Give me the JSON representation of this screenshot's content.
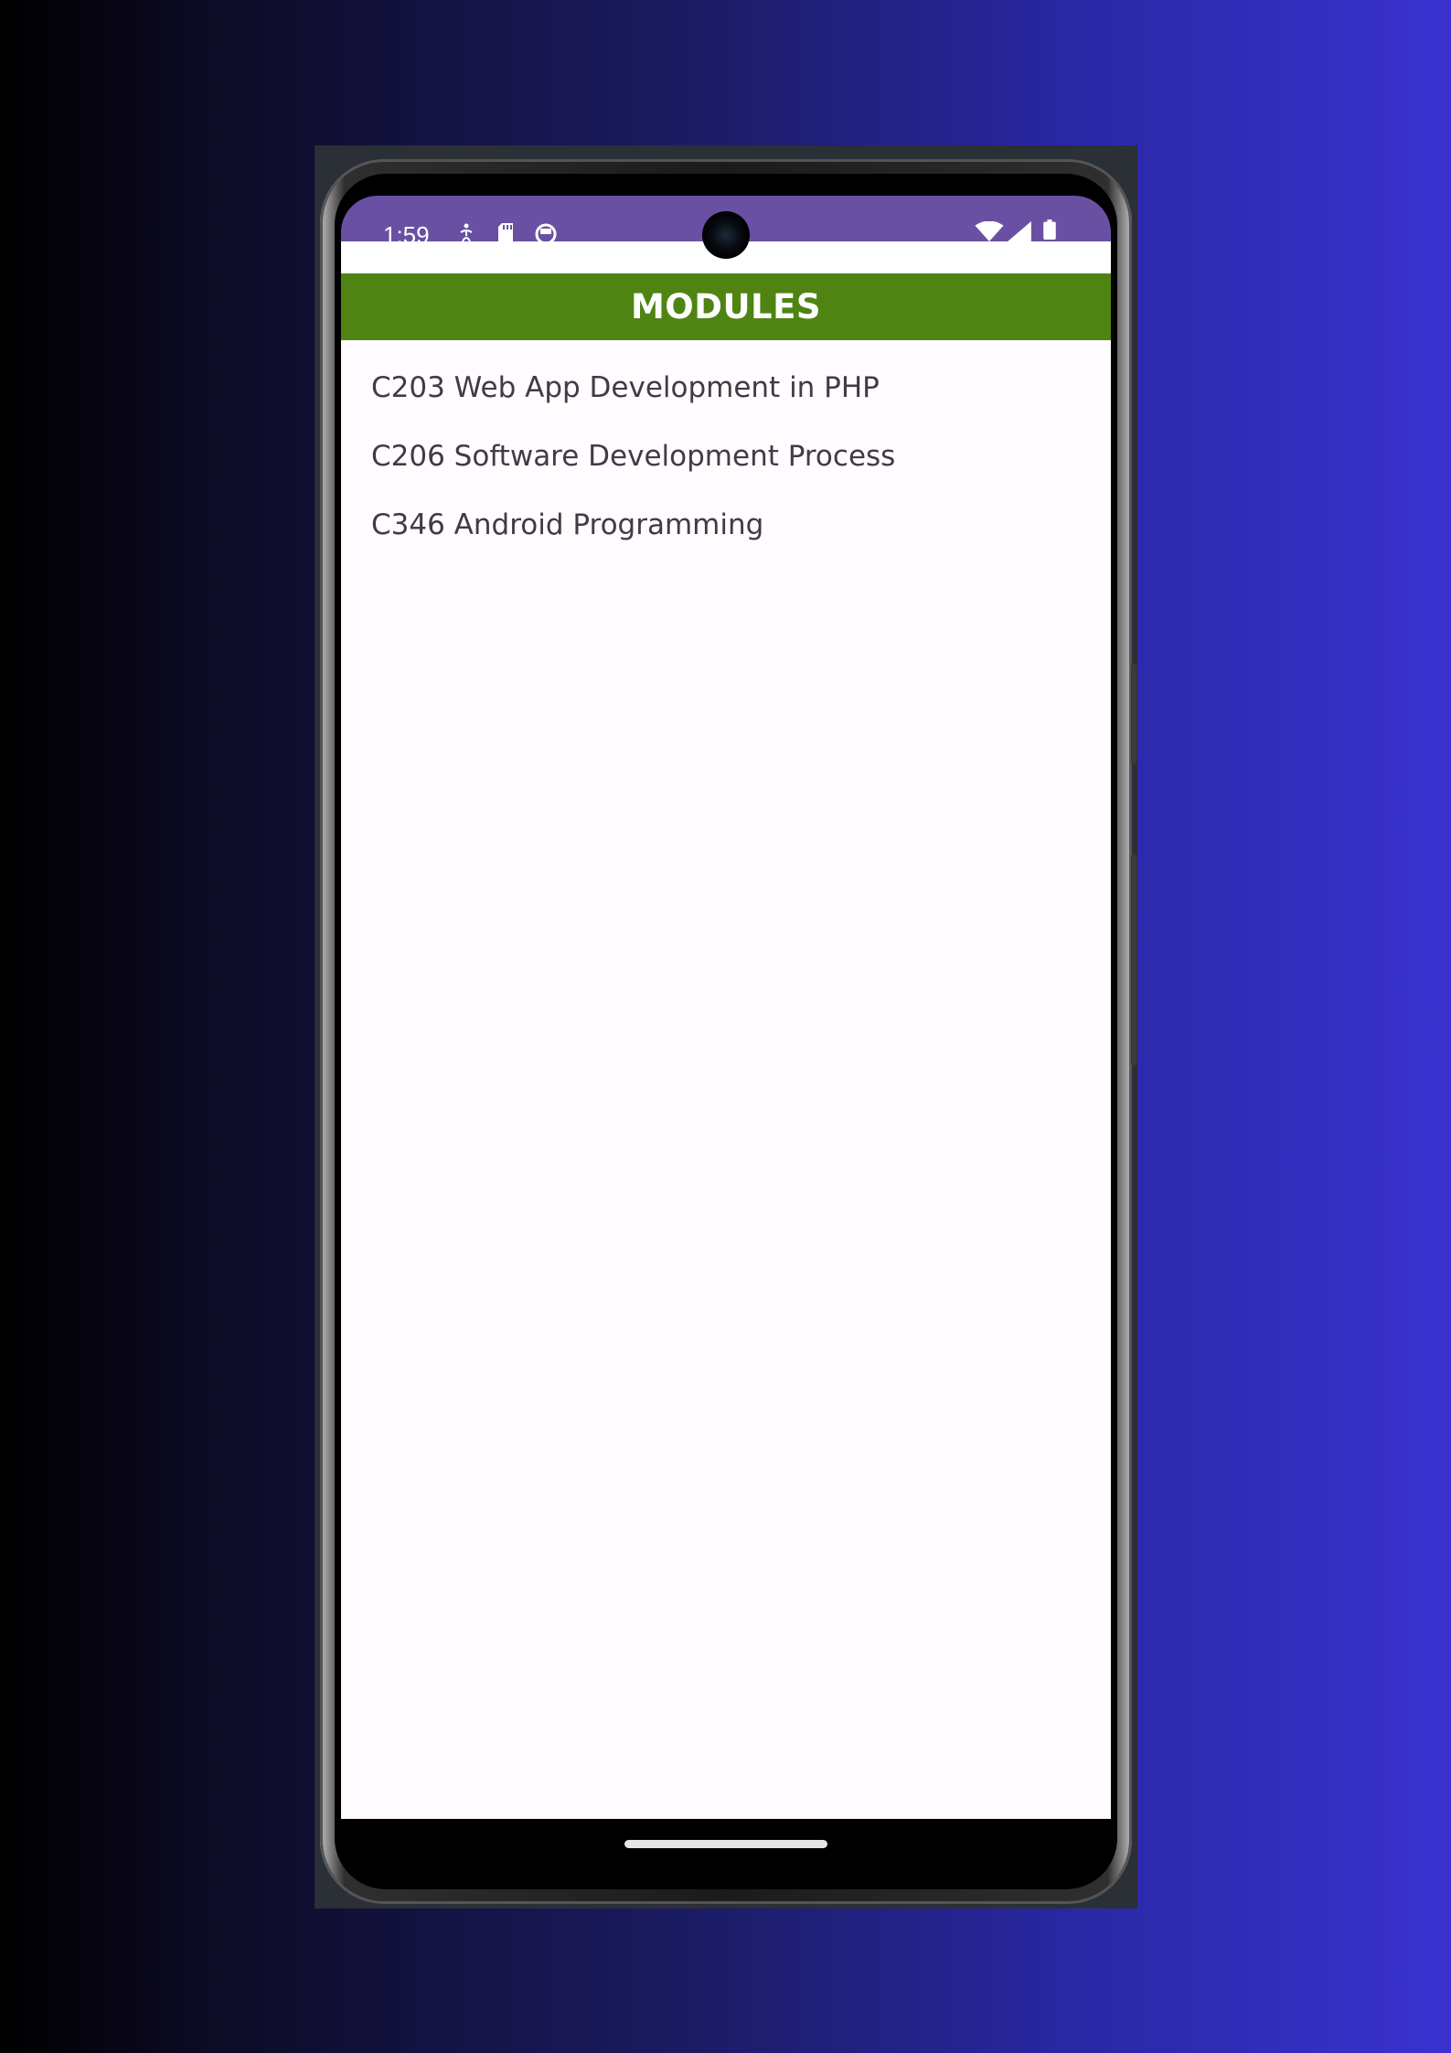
{
  "status_bar": {
    "time": "1:59",
    "left_icons": [
      "accessibility-icon",
      "sd-card-icon",
      "app-notification-icon"
    ],
    "right_icons": [
      "wifi-icon",
      "cellular-signal-icon",
      "battery-icon"
    ]
  },
  "app": {
    "title": "MODULES",
    "header_color": "#4f8413",
    "status_bar_color": "#6a50a3"
  },
  "modules": [
    "C203 Web App Development in PHP",
    "C206 Software Development Process",
    "C346 Android Programming"
  ]
}
